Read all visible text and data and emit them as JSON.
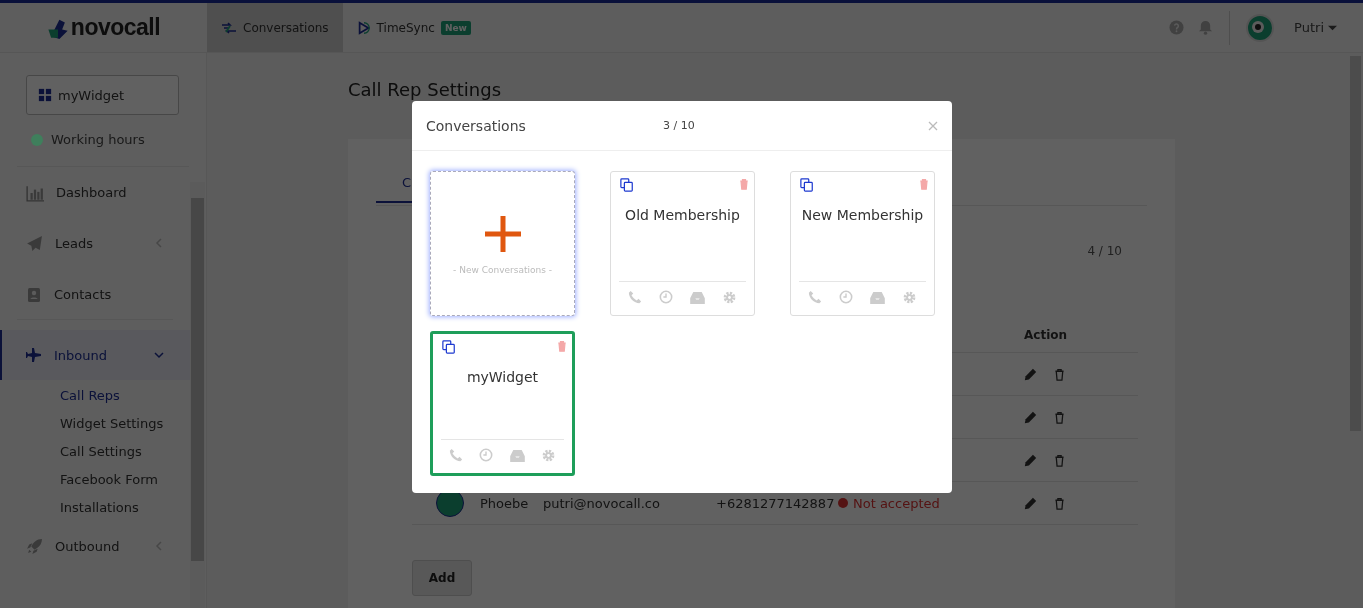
{
  "header": {
    "logo": "novocall",
    "tabs": [
      {
        "label": "Conversations",
        "selected": true
      },
      {
        "label": "TimeSync",
        "badge": "New",
        "selected": false
      }
    ],
    "user": "Putri"
  },
  "sidebar": {
    "widget": "myWidget",
    "status": {
      "label": "Working hours",
      "color": "#3f7f5c"
    },
    "menu": [
      {
        "label": "Dashboard",
        "kind": "link",
        "selected": false
      },
      {
        "label": "Leads",
        "kind": "group",
        "expanded": false,
        "selected": false
      },
      {
        "label": "Contacts",
        "kind": "link",
        "selected": false
      },
      {
        "label": "Inbound",
        "kind": "group",
        "expanded": true,
        "selected": true,
        "children": [
          {
            "label": "Call Reps",
            "selected": true
          },
          {
            "label": "Widget Settings",
            "selected": false
          },
          {
            "label": "Call Settings",
            "selected": false
          },
          {
            "label": "Facebook Form",
            "selected": false
          },
          {
            "label": "Installations",
            "selected": false
          }
        ]
      },
      {
        "label": "Outbound",
        "kind": "group",
        "expanded": false,
        "selected": false
      }
    ]
  },
  "page": {
    "title": "Call Rep Settings",
    "tab": "C",
    "counter": "4 / 10",
    "column": "Action",
    "rows": [
      {},
      {},
      {},
      {
        "name": "Phoebe",
        "email": "putri@novocall.co",
        "phone": "+6281277142887",
        "status": "Not accepted"
      }
    ],
    "add": "Add"
  },
  "modal": {
    "title": "Conversations",
    "count": "3 / 10",
    "new_label": "- New Conversations -",
    "widgets": [
      {
        "name": "Old Membership",
        "selected": false
      },
      {
        "name": "New Membership",
        "selected": false
      },
      {
        "name": "myWidget",
        "selected": true
      }
    ]
  }
}
